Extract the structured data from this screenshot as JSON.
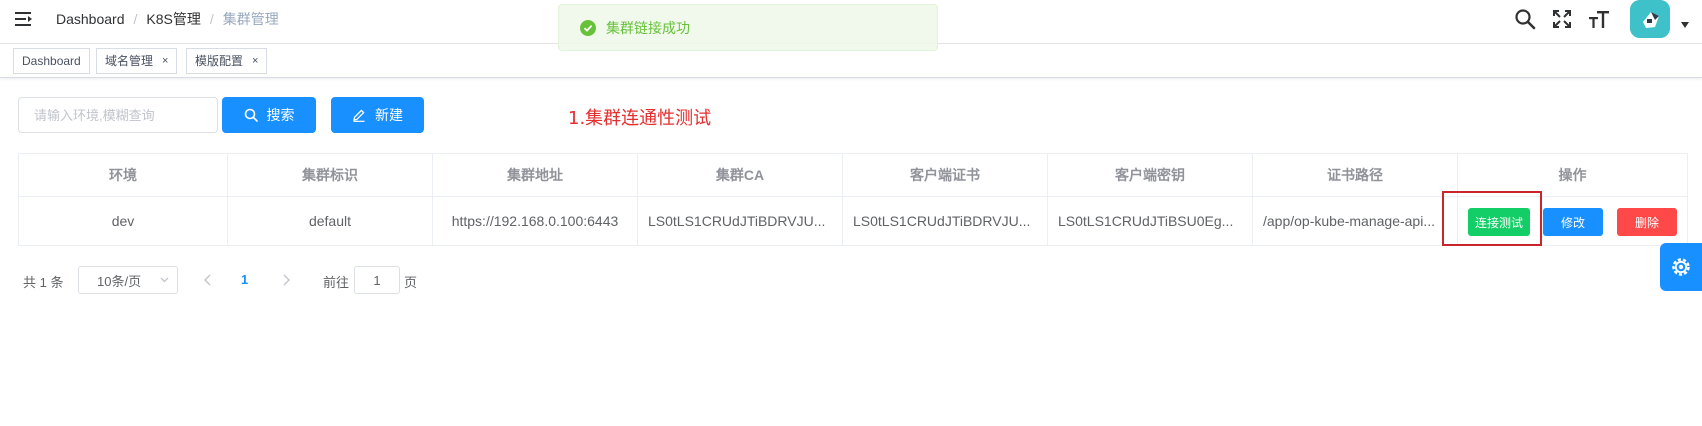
{
  "header": {
    "breadcrumb": [
      "Dashboard",
      "K8S管理",
      "集群管理"
    ]
  },
  "message": {
    "text": "集群链接成功",
    "type": "success"
  },
  "tags": [
    {
      "label": "Dashboard",
      "closable": false
    },
    {
      "label": "域名管理",
      "closable": true,
      "close": "×"
    },
    {
      "label": "模版配置",
      "closable": true,
      "close": "×"
    }
  ],
  "toolbar": {
    "search_placeholder": "请输入环境,模糊查询",
    "search_label": "搜索",
    "add_label": "新建"
  },
  "annotation": "1.集群连通性测试",
  "table": {
    "columns": [
      "环境",
      "集群标识",
      "集群地址",
      "集群CA",
      "客户端证书",
      "客户端密钥",
      "证书路径",
      "操作"
    ],
    "rows": [
      {
        "env": "dev",
        "cluster_id": "default",
        "address": "https://192.168.0.100:6443",
        "ca": "LS0tLS1CRUdJTiBDRVJU...",
        "client_cert": "LS0tLS1CRUdJTiBDRVJU...",
        "client_key": "LS0tLS1CRUdJTiBSU0Eg...",
        "cert_path": "/app/op-kube-manage-api...",
        "actions": {
          "test": "连接测试",
          "edit": "修改",
          "delete": "删除"
        }
      }
    ]
  },
  "pagination": {
    "total": "共 1 条",
    "page_size": "10条/页",
    "current": "1",
    "goto": "前往",
    "goto_value": "1",
    "page_unit": "页"
  },
  "colors": {
    "primary": "#1890ff",
    "success": "#13ce66",
    "danger": "#ff4949",
    "annotation": "#e52e2e",
    "highlight_box": "#c9262b"
  }
}
